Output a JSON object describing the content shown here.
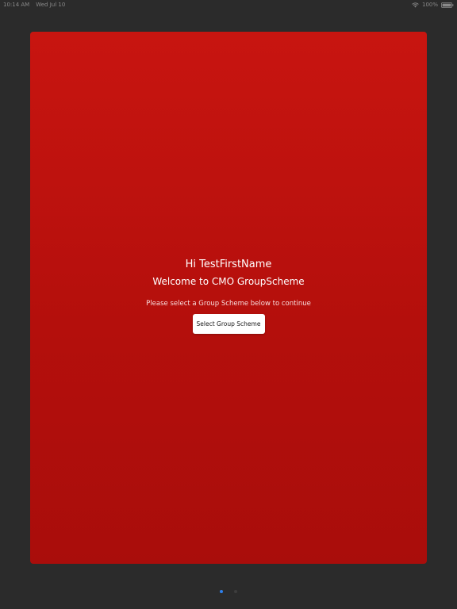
{
  "status_bar": {
    "time": "10:14 AM",
    "date": "Wed Jul 10",
    "battery": "100%",
    "icons": [
      "wifi-icon",
      "battery-icon"
    ]
  },
  "welcome": {
    "greeting": "Hi TestFirstName",
    "title": "Welcome to CMO GroupScheme",
    "instruction": "Please select a Group Scheme below to continue",
    "button_label": "Select Group Scheme"
  },
  "pagination": {
    "pages": 2,
    "current_page": 1
  },
  "colors": {
    "card": "#b9110d",
    "background": "#2b2b2b",
    "active_dot": "#2f80ed",
    "inactive_dot": "#3d3d3d"
  }
}
